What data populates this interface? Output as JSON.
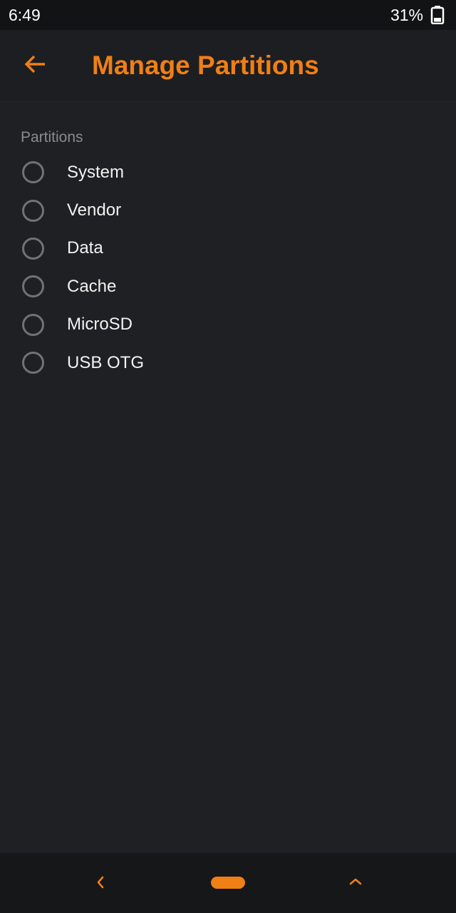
{
  "status_bar": {
    "time": "6:49",
    "battery_percent": "31%",
    "battery_icon": "battery-icon"
  },
  "app_bar": {
    "back_icon": "arrow-left-icon",
    "title": "Manage Partitions"
  },
  "partitions": {
    "header": "Partitions",
    "options": [
      {
        "label": "System",
        "selected": false
      },
      {
        "label": "Vendor",
        "selected": false
      },
      {
        "label": "Data",
        "selected": false
      },
      {
        "label": "Cache",
        "selected": false
      },
      {
        "label": "MicroSD",
        "selected": false
      },
      {
        "label": "USB OTG",
        "selected": false
      }
    ]
  },
  "nav_bar": {
    "back_icon": "chevron-left-icon",
    "home_icon": "home-pill-icon",
    "recents_icon": "chevron-up-icon"
  },
  "colors": {
    "accent": "#f07f16",
    "background": "#1f2023",
    "text_primary": "#f2f2f2",
    "text_secondary": "#8a8b8f",
    "radio_outline": "#717275"
  }
}
